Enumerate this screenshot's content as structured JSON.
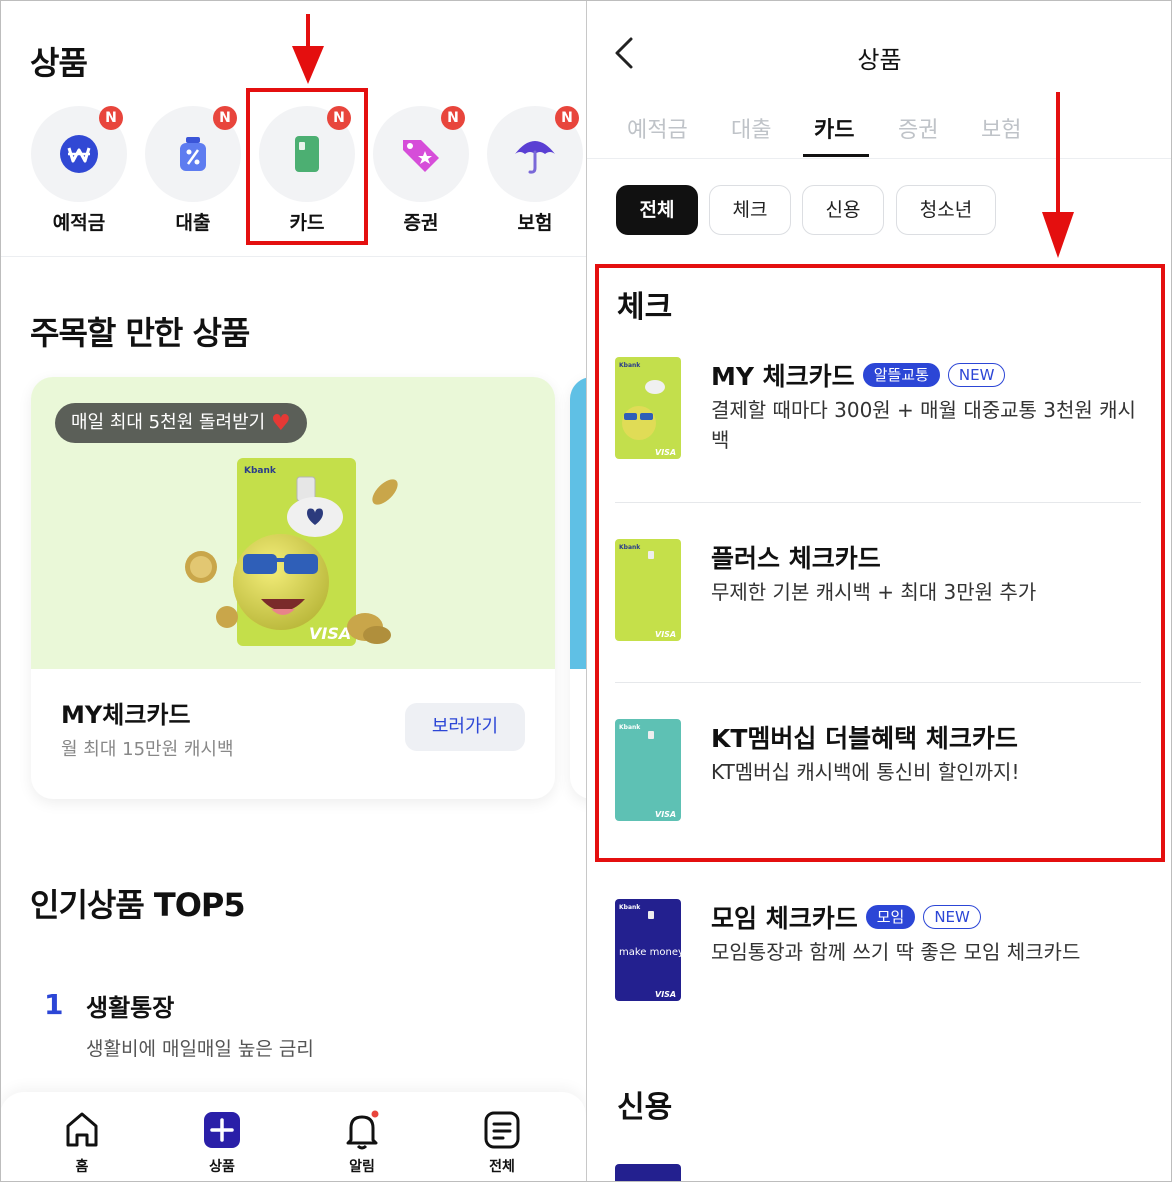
{
  "left": {
    "page_title": "상품",
    "categories": [
      {
        "label": "예적금",
        "icon": "won-coin-icon",
        "badge": "N"
      },
      {
        "label": "대출",
        "icon": "percent-jar-icon",
        "badge": "N"
      },
      {
        "label": "카드",
        "icon": "card-icon",
        "badge": "N"
      },
      {
        "label": "증권",
        "icon": "price-tag-icon",
        "badge": "N"
      },
      {
        "label": "보험",
        "icon": "umbrella-icon",
        "badge": "N"
      }
    ],
    "featured_title": "주목할 만한 상품",
    "featured": {
      "pill": "매일 최대 5천원 돌려받기",
      "pill_icon": "heart-icon",
      "card_brand": "Kbank",
      "card_network": "VISA",
      "name": "MY체크카드",
      "desc": "월 최대 15만원 캐시백",
      "button": "보러가기"
    },
    "top5_title": "인기상품 TOP5",
    "top5": [
      {
        "rank": "1",
        "name": "생활통장",
        "desc": "생활비에 매일매일 높은 금리"
      }
    ],
    "nav": [
      {
        "label": "홈",
        "icon": "home-icon"
      },
      {
        "label": "상품",
        "icon": "plus-square-icon"
      },
      {
        "label": "알림",
        "icon": "bell-icon"
      },
      {
        "label": "전체",
        "icon": "menu-doc-icon"
      }
    ]
  },
  "right": {
    "title": "상품",
    "tabs": [
      "예적금",
      "대출",
      "카드",
      "증권",
      "보험"
    ],
    "active_tab": "카드",
    "filters": [
      "전체",
      "체크",
      "신용",
      "청소년"
    ],
    "active_filter": "전체",
    "section_check": "체크",
    "products": [
      {
        "name": "MY 체크카드",
        "tags": [
          "알뜰교통",
          "NEW"
        ],
        "desc": "결제할 때마다 300원 + 매월 대중교통 3천원 캐시백",
        "thumb_color": "#c3df4c"
      },
      {
        "name": "플러스 체크카드",
        "tags": [],
        "desc": "무제한 기본 캐시백 + 최대 3만원 추가",
        "thumb_color": "#c5e04a"
      },
      {
        "name": "KT멤버십 더블혜택 체크카드",
        "tags": [],
        "desc": "KT멤버십 캐시백에 통신비 할인까지!",
        "thumb_color": "#5ec1b4"
      },
      {
        "name": "모임 체크카드",
        "tags": [
          "모임",
          "NEW"
        ],
        "desc": "모임통장과 함께 쓰기 딱 좋은 모임 체크카드",
        "thumb_color": "#23208f"
      }
    ],
    "section_credit": "신용",
    "thumb_brand": "Kbank",
    "thumb_network": "VISA",
    "make_money_text": "make money"
  },
  "colors": {
    "accent_blue": "#2c46d6",
    "highlight_red": "#e40f0f",
    "badge_red": "#e8453c"
  }
}
